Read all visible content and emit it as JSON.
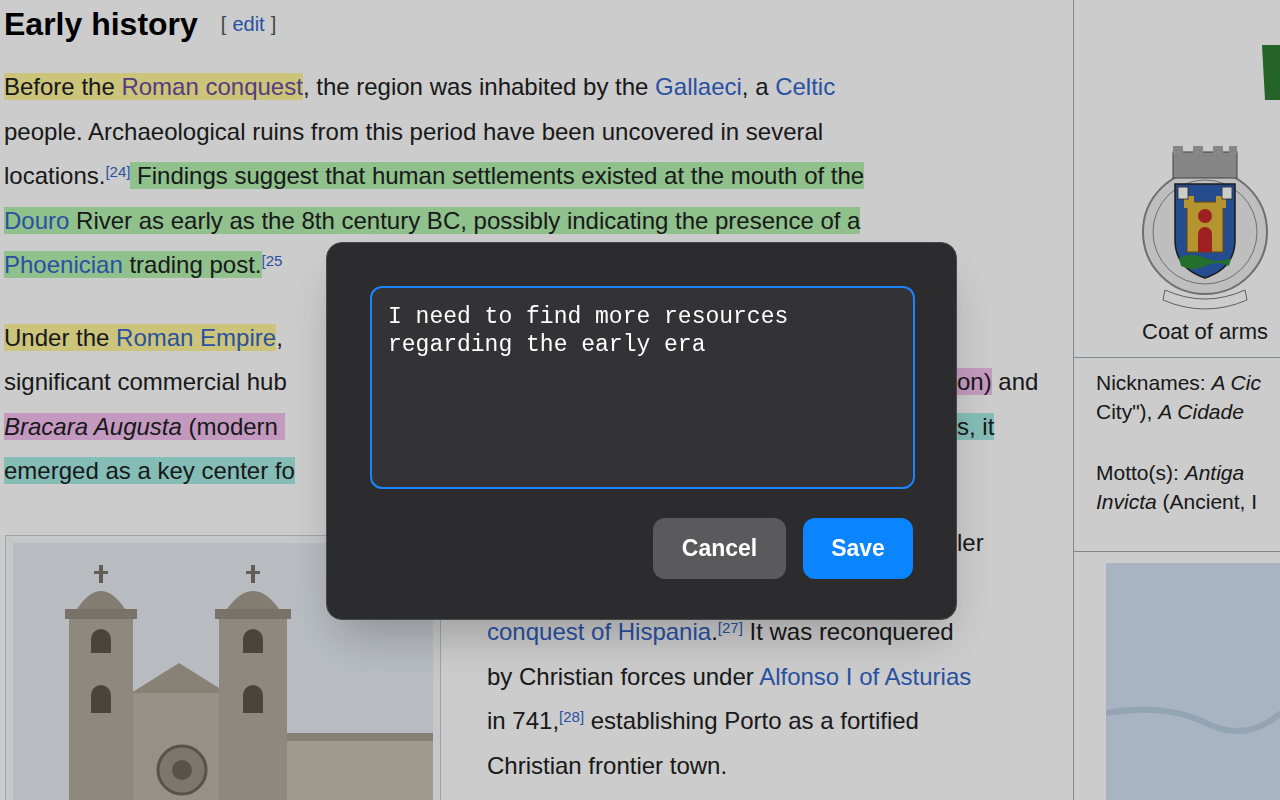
{
  "article": {
    "heading": {
      "title": "Early history",
      "edit": {
        "open": "[",
        "label": "edit",
        "close": "]"
      }
    },
    "intro_lines": [
      [
        {
          "text": "Before the ",
          "kind": "text",
          "color": "#fff59a"
        },
        {
          "text": "Roman conquest",
          "kind": "visited",
          "color": "#fff59a"
        },
        {
          "text": ", the region was inhabited by the ",
          "kind": "text"
        },
        {
          "text": "Gallaeci",
          "kind": "link"
        },
        {
          "text": ", a ",
          "kind": "text"
        },
        {
          "text": "Celtic",
          "kind": "link"
        }
      ],
      [
        {
          "text": "people. Archaeological ruins from this period have been uncovered in several",
          "kind": "text"
        }
      ],
      [
        {
          "text": "locations.",
          "kind": "text"
        },
        {
          "text": "[24]",
          "kind": "ref"
        },
        {
          "text": " Findings suggest that human settlements existed at the mouth of the",
          "kind": "text",
          "color": "#b4f0ae"
        }
      ],
      [
        {
          "text": "Douro",
          "kind": "link",
          "color": "#b4f0ae"
        },
        {
          "text": " River as early as the 8th century BC, possibly indicating the presence of a",
          "kind": "text",
          "color": "#b4f0ae"
        }
      ],
      [
        {
          "text": "Phoenician",
          "kind": "link",
          "color": "#b4f0ae"
        },
        {
          "text": " trading post.",
          "kind": "text",
          "color": "#b4f0ae"
        },
        {
          "text": "[25",
          "kind": "ref"
        }
      ]
    ],
    "roman_rows": [
      {
        "left": [
          {
            "text": "Under the ",
            "kind": "text",
            "color": "#fff59a"
          },
          {
            "text": "Roman Empire",
            "kind": "link",
            "color": "#fff59a"
          },
          {
            "text": ",",
            "kind": "text"
          }
        ],
        "right": []
      },
      {
        "left": [
          {
            "text": "significant commercial hub",
            "kind": "text"
          }
        ],
        "right": [
          {
            "text": "on)",
            "kind": "text",
            "color": "#f5c0f0"
          },
          {
            "text": " and",
            "kind": "text"
          }
        ]
      },
      {
        "left": [
          {
            "text": "Bracara Augusta",
            "kind": "italic",
            "color": "#f5c0f0"
          },
          {
            "text": " (modern ",
            "kind": "text",
            "color": "#f5c0f0"
          }
        ],
        "right": [
          {
            "text": "s, it",
            "kind": "text",
            "color": "#a6ede4"
          }
        ]
      },
      {
        "left": [
          {
            "text": "emerged as a key center fo",
            "kind": "text",
            "color": "#a6ede4"
          }
        ],
        "right": []
      }
    ],
    "column_rows": [
      {
        "left": [],
        "right": [
          {
            "text": "ler",
            "kind": "text"
          }
        ]
      },
      {
        "left": [],
        "right": []
      },
      {
        "left": [
          {
            "text": "conquest of Hispania",
            "kind": "link"
          },
          {
            "text": ".",
            "kind": "text"
          },
          {
            "text": "[27]",
            "kind": "ref"
          },
          {
            "text": " It was reconquered",
            "kind": "text"
          }
        ],
        "right": []
      },
      {
        "left": [
          {
            "text": "by Christian forces under ",
            "kind": "text"
          },
          {
            "text": "Alfonso I of Asturias",
            "kind": "link"
          }
        ],
        "right": []
      },
      {
        "left": [
          {
            "text": "in 741,",
            "kind": "text"
          },
          {
            "text": "[28]",
            "kind": "ref"
          },
          {
            "text": " establishing Porto as a fortified",
            "kind": "text"
          }
        ],
        "right": []
      },
      {
        "left": [
          {
            "text": "Christian frontier town.",
            "kind": "text"
          }
        ],
        "right": []
      }
    ]
  },
  "infobox": {
    "caption": "Coat of arms",
    "rows": [
      [
        [
          {
            "text": "Nicknames: ",
            "kind": "text"
          },
          {
            "text": "A Cic",
            "kind": "italic"
          }
        ],
        [
          {
            "text": "City\"), ",
            "kind": "text"
          },
          {
            "text": "A Cidade",
            "kind": "italic"
          }
        ]
      ],
      [
        [
          {
            "text": "Motto(s): ",
            "kind": "text"
          },
          {
            "text": "Antiga",
            "kind": "italic"
          }
        ],
        [
          {
            "text": "Invicta",
            "kind": "italic"
          },
          {
            "text": " (Ancient, I",
            "kind": "text"
          }
        ]
      ]
    ]
  },
  "dialog": {
    "note": "I need to find more resources regarding the early era",
    "focused": true,
    "buttons": [
      {
        "label": "Cancel",
        "kind": "secondary"
      },
      {
        "label": "Save",
        "kind": "primary"
      }
    ]
  }
}
